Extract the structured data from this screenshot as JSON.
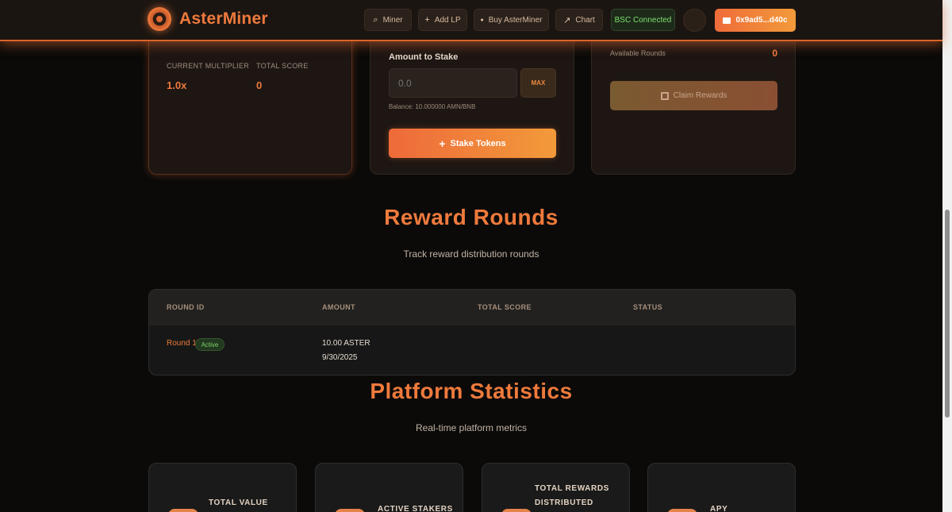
{
  "header": {
    "brand": "AsterMiner",
    "nav": [
      {
        "label": "Miner",
        "icon": "search-icon",
        "glyph": "⌕"
      },
      {
        "label": "Add LP",
        "icon": "plus-icon",
        "glyph": "+"
      },
      {
        "label": "Buy AsterMiner",
        "icon": "fire-icon",
        "glyph": "●"
      },
      {
        "label": "Chart",
        "icon": "chart-line-icon",
        "glyph": "↗"
      }
    ],
    "network_status": "BSC Connected",
    "wallet_label": "0x9ad5...d40c"
  },
  "cards": {
    "left": {
      "multiplier_label": "CURRENT MULTIPLIER",
      "multiplier_value": "1.0x",
      "score_label": "TOTAL SCORE",
      "score_value": "0"
    },
    "stake": {
      "amount_label": "Amount to Stake",
      "amount_value": "0.0",
      "max_label": "MAX",
      "balance": "Balance: 10.000000 AMN/BNB",
      "stake_button": "Stake Tokens"
    },
    "rewards": {
      "available_label": "Available Rounds",
      "available_value": "0",
      "claim_button": "Claim Rewards"
    }
  },
  "reward_rounds": {
    "title": "Reward Rounds",
    "subtitle": "Track reward distribution rounds",
    "columns": [
      "ROUND ID",
      "AMOUNT",
      "TOTAL SCORE",
      "STATUS"
    ],
    "rows": [
      {
        "round": "Round 1",
        "badge": "Active",
        "amount": "10.00 ASTER",
        "date": "9/30/2025",
        "total_score": "",
        "status": ""
      }
    ]
  },
  "platform_stats": {
    "title": "Platform Statistics",
    "subtitle": "Real-time platform metrics",
    "cards": [
      {
        "line1": "TOTAL VALUE",
        "line2": ""
      },
      {
        "line1": "ACTIVE STAKERS",
        "line2": ""
      },
      {
        "line1": "TOTAL REWARDS",
        "line2": "DISTRIBUTED"
      },
      {
        "line1": "APY",
        "line2": ""
      }
    ]
  },
  "colors": {
    "accent": "#ee7a3c",
    "background": "#0b0a09",
    "connected": "#7de06a"
  }
}
